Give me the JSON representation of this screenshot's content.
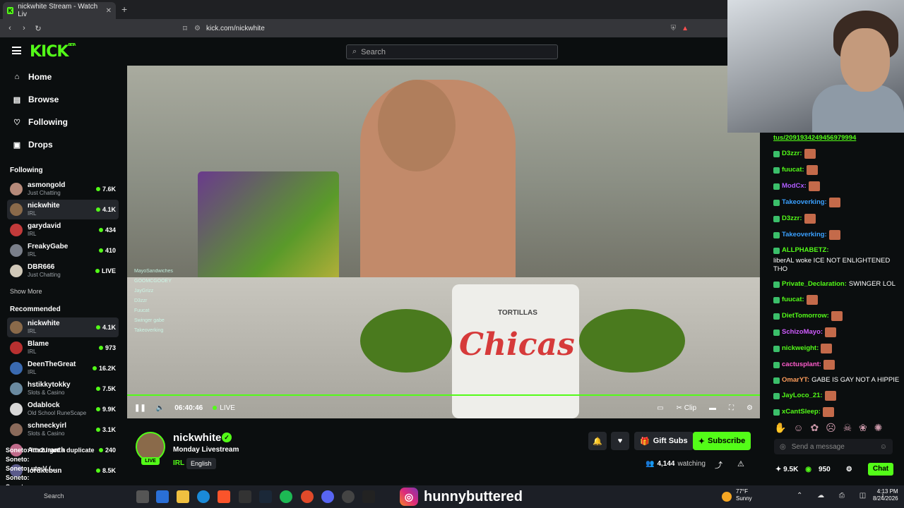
{
  "browser": {
    "tab_title": "nickwhite Stream - Watch Liv",
    "url": "kick.com/nickwhite"
  },
  "header": {
    "logo": "KICK",
    "logo_badge": "BETA",
    "search_placeholder": "Search"
  },
  "sidebar": {
    "nav": [
      "Home",
      "Browse",
      "Following",
      "Drops"
    ],
    "following_title": "Following",
    "following": [
      {
        "name": "asmongold",
        "category": "Just Chatting",
        "viewers": "7.6K",
        "color": "#b68a7a"
      },
      {
        "name": "nickwhite",
        "category": "IRL",
        "viewers": "4.1K",
        "color": "#8a6a4a"
      },
      {
        "name": "garydavid",
        "category": "IRL",
        "viewers": "434",
        "color": "#c23a3a"
      },
      {
        "name": "FreakyGabe",
        "category": "IRL",
        "viewers": "410",
        "color": "#7a7f8a"
      },
      {
        "name": "DBR666",
        "category": "Just Chatting",
        "viewers": "LIVE",
        "color": "#d0c8b8"
      }
    ],
    "show_more": "Show More",
    "recommended_title": "Recommended",
    "recommended": [
      {
        "name": "nickwhite",
        "category": "IRL",
        "viewers": "4.1K",
        "color": "#8a6a4a"
      },
      {
        "name": "Blame",
        "category": "IRL",
        "viewers": "973",
        "color": "#b83030"
      },
      {
        "name": "DeenTheGreat",
        "category": "IRL",
        "viewers": "16.2K",
        "color": "#3a6ab0"
      },
      {
        "name": "hstikkytokky",
        "category": "Slots & Casino",
        "viewers": "7.5K",
        "color": "#6a8aa0"
      },
      {
        "name": "Odablock",
        "category": "Old School RuneScape",
        "viewers": "9.9K",
        "color": "#d8d8d8"
      },
      {
        "name": "schneckyirl",
        "category": "Slots & Casino",
        "viewers": "3.1K",
        "color": "#8a6a5a"
      },
      {
        "name": "Amouranth",
        "category": "",
        "viewers": "240",
        "color": "#c06a8a"
      },
      {
        "name": "lordkebun",
        "category": "",
        "viewers": "8.5K",
        "color": "#5a5a8a"
      }
    ]
  },
  "video": {
    "time": "06:40:46",
    "live_label": "LIVE",
    "clip_label": "Clip",
    "product_text": "Chicas",
    "product_sub": "TORTILLAS",
    "overlay_chat": [
      "MayoSandwiches",
      "GOOMCGOOEY",
      "JayGrizz",
      "D3zzr",
      "Fuucat",
      "Swinger gabe",
      "Takeoverking"
    ]
  },
  "channel": {
    "name": "nickwhite",
    "title": "Monday Livestream",
    "category": "IRL",
    "language": "English",
    "live_badge": "LIVE",
    "gift_subs": "Gift Subs",
    "subscribe": "Subscribe",
    "watching_count": "4,144",
    "watching_label": "watching"
  },
  "chat": {
    "top_link": "tus/2091934249456979994",
    "messages": [
      {
        "user": "D3zzr:",
        "color": "#53fc18",
        "text": "",
        "emote": true
      },
      {
        "user": "fuucat:",
        "color": "#53fc18",
        "text": "",
        "emote": true
      },
      {
        "user": "ModCx:",
        "color": "#b05cff",
        "text": "",
        "emote": true
      },
      {
        "user": "Takeoverking:",
        "color": "#3aa0ff",
        "text": "",
        "emote": true
      },
      {
        "user": "D3zzr:",
        "color": "#53fc18",
        "text": "",
        "emote": true
      },
      {
        "user": "Takeoverking:",
        "color": "#3aa0ff",
        "text": "",
        "emote": true
      },
      {
        "user": "ALLPHABETZ:",
        "color": "#53fc18",
        "text": "liberAL woke ICE NOT ENLIGHTENED THO",
        "emote": false
      },
      {
        "user": "Private_Declaration:",
        "color": "#53fc18",
        "text": "SWINGER LOL",
        "emote": false
      },
      {
        "user": "fuucat:",
        "color": "#53fc18",
        "text": "",
        "emote": true
      },
      {
        "user": "DietTomorrow:",
        "color": "#53fc18",
        "text": "",
        "emote": true
      },
      {
        "user": "SchizoMayo:",
        "color": "#d05cff",
        "text": "",
        "emote": true
      },
      {
        "user": "nickweight:",
        "color": "#53fc18",
        "text": "",
        "emote": true
      },
      {
        "user": "cactusplant:",
        "color": "#ff5ccc",
        "text": "",
        "emote": true
      },
      {
        "user": "OmarYT:",
        "color": "#ff9d5c",
        "text": "GABE IS GAY NOT A HIPPIE",
        "emote": false
      },
      {
        "user": "JayLoco_21:",
        "color": "#53fc18",
        "text": "",
        "emote": true
      },
      {
        "user": "xCantSleep:",
        "color": "#53fc18",
        "text": "",
        "emote": true
      }
    ],
    "input_placeholder": "Send a message",
    "points": "9.5K",
    "kicks": "950",
    "chat_button": "Chat"
  },
  "overlay": {
    "lines": [
      "Soneto: Itts2 I got a duplicate",
      "Soneto:",
      "Soneto: uto V (...",
      "Soneto:",
      "Soneto:"
    ]
  },
  "taskbar": {
    "search_label": "Search",
    "instagram_handle": "hunnybuttered",
    "weather_temp": "77°F",
    "weather_desc": "Sunny",
    "time": "4:13 PM",
    "date": "8/24/2026"
  },
  "colors": {
    "accent": "#53fc18",
    "bg": "#0b0e0f",
    "panel": "#24272c"
  }
}
